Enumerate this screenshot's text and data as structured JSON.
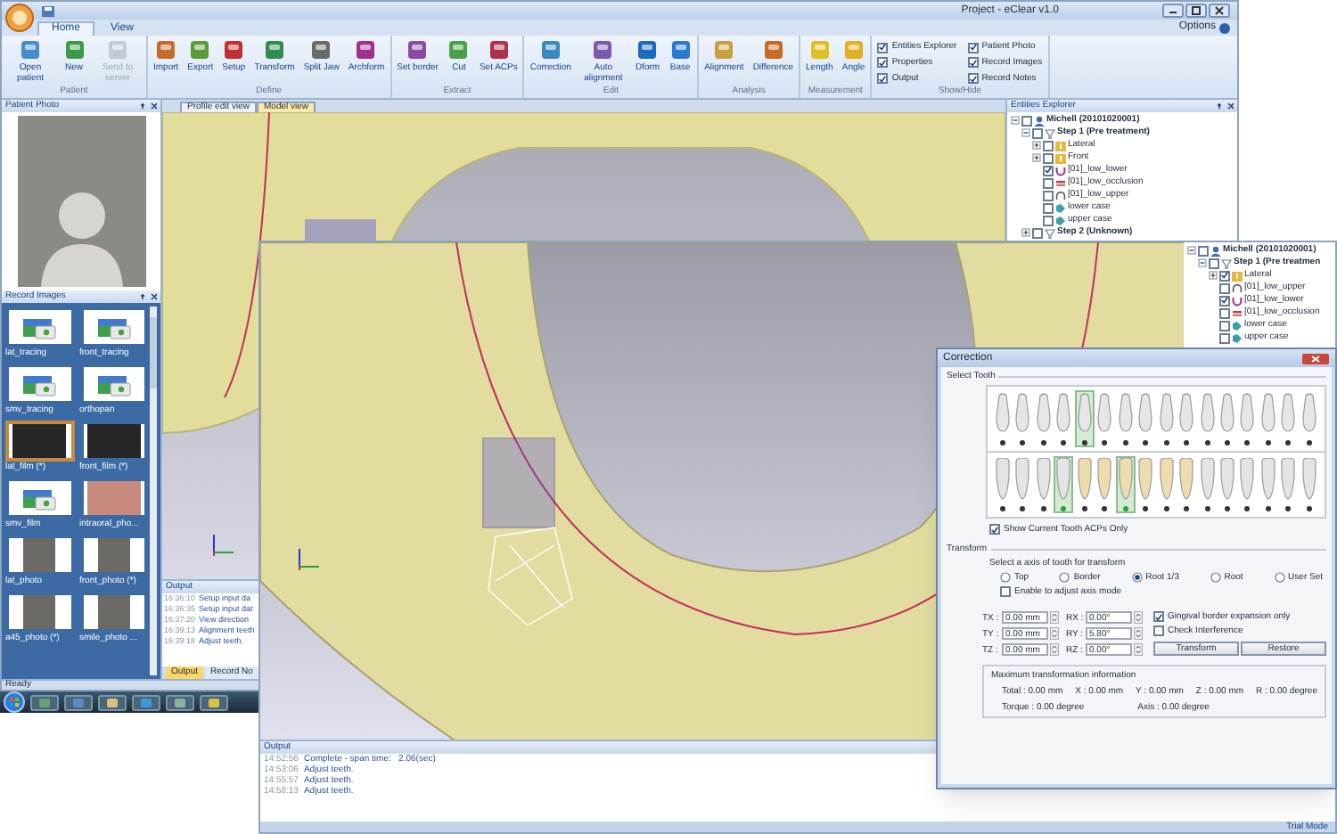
{
  "main_window": {
    "title": "Project - eClear v1.0",
    "tabs": [
      {
        "label": "Home",
        "selected": true
      },
      {
        "label": "View",
        "selected": false
      }
    ],
    "options": "Options",
    "ribbon_groups": [
      {
        "label": "Patient",
        "buttons": [
          {
            "label": "Open patient",
            "disabled": false
          },
          {
            "label": "New",
            "disabled": false
          },
          {
            "label": "Send to server",
            "disabled": true
          }
        ]
      },
      {
        "label": "Define",
        "buttons": [
          {
            "label": "Import",
            "disabled": false
          },
          {
            "label": "Export",
            "disabled": false
          },
          {
            "label": "Setup",
            "disabled": false
          },
          {
            "label": "Transform",
            "disabled": false
          },
          {
            "label": "Split Jaw",
            "disabled": false
          },
          {
            "label": "Archform",
            "disabled": false
          }
        ]
      },
      {
        "label": "Extract",
        "buttons": [
          {
            "label": "Set border",
            "disabled": false
          },
          {
            "label": "Cut",
            "disabled": false
          },
          {
            "label": "Set ACPs",
            "disabled": false
          }
        ]
      },
      {
        "label": "Edit",
        "buttons": [
          {
            "label": "Correction",
            "disabled": false
          },
          {
            "label": "Auto alignment",
            "disabled": false
          },
          {
            "label": "Dform",
            "disabled": false
          },
          {
            "label": "Base",
            "disabled": false
          }
        ]
      },
      {
        "label": "Analysis",
        "buttons": [
          {
            "label": "Alignment",
            "disabled": false
          },
          {
            "label": "Difference",
            "disabled": false
          }
        ]
      },
      {
        "label": "Measurement",
        "buttons": [
          {
            "label": "Length",
            "disabled": false
          },
          {
            "label": "Angle",
            "disabled": false
          }
        ]
      }
    ],
    "show_hide": {
      "label": "Show/Hide",
      "items": [
        {
          "label": "Entities Explorer",
          "checked": true
        },
        {
          "label": "Properties",
          "checked": true
        },
        {
          "label": "Output",
          "checked": true
        },
        {
          "label": "Patient Photo",
          "checked": true
        },
        {
          "label": "Record Images",
          "checked": true
        },
        {
          "label": "Record Notes",
          "checked": true
        }
      ]
    },
    "patient_photo": {
      "title": "Patient Photo"
    },
    "record_images": {
      "title": "Record Images",
      "items": [
        {
          "label": "lat_tracing",
          "kind": "icon",
          "selected": false
        },
        {
          "label": "front_tracing",
          "kind": "icon",
          "selected": false
        },
        {
          "label": "smv_tracing",
          "kind": "icon",
          "selected": false
        },
        {
          "label": "orthopan",
          "kind": "icon",
          "selected": false
        },
        {
          "label": "lat_film (*)",
          "kind": "xray",
          "selected": true
        },
        {
          "label": "front_film (*)",
          "kind": "xray",
          "selected": false
        },
        {
          "label": "smv_film",
          "kind": "icon",
          "selected": false
        },
        {
          "label": "intraoral_pho...",
          "kind": "intraoral",
          "selected": false
        },
        {
          "label": "lat_photo",
          "kind": "photo",
          "selected": false
        },
        {
          "label": "front_photo (*)",
          "kind": "photo",
          "selected": false
        },
        {
          "label": "a45_photo (*)",
          "kind": "photo",
          "selected": false
        },
        {
          "label": "smile_photo ...",
          "kind": "photo",
          "selected": false
        }
      ]
    },
    "view_tabs": [
      {
        "label": "Profile edit view",
        "selected": false
      },
      {
        "label": "Model view",
        "selected": true
      }
    ],
    "entities_explorer": {
      "title": "Entities Explorer",
      "tree": [
        {
          "label": "Michell (20101020001)",
          "kind": "patient",
          "checked": false,
          "expanded": true,
          "children": [
            {
              "label": "Step 1 (Pre treatment)",
              "kind": "step",
              "checked": false,
              "expanded": true,
              "children": [
                {
                  "label": "Lateral",
                  "kind": "group",
                  "checked": false,
                  "expanded": false
                },
                {
                  "label": "Front",
                  "kind": "group",
                  "checked": false,
                  "expanded": false
                },
                {
                  "label": "[01]_low_lower",
                  "kind": "arch",
                  "checked": true
                },
                {
                  "label": "[01]_low_occlusion",
                  "kind": "occlusion",
                  "checked": false
                },
                {
                  "label": "[01]_low_upper",
                  "kind": "upper",
                  "checked": false
                },
                {
                  "label": "lower case",
                  "kind": "case",
                  "checked": false
                },
                {
                  "label": "upper case",
                  "kind": "case",
                  "checked": false
                }
              ]
            },
            {
              "label": "Step 2 (Unknown)",
              "kind": "step",
              "checked": false,
              "expanded": false
            }
          ]
        }
      ]
    },
    "output": {
      "title": "Output",
      "lines": [
        {
          "time": "16:36:10",
          "text": "Setup input da"
        },
        {
          "time": "16:36:35",
          "text": "Setup input dat"
        },
        {
          "time": "16:37:20",
          "text": "View direction"
        },
        {
          "time": "16:39:13",
          "text": "Alignment teeth"
        },
        {
          "time": "16:39:18",
          "text": "Adjust teeth."
        }
      ],
      "tabs": [
        {
          "label": "Output",
          "selected": true
        },
        {
          "label": "Record No",
          "selected": false
        }
      ]
    },
    "status": "Ready"
  },
  "second_window": {
    "entities_tree": [
      {
        "label": "Michell (20101020001)",
        "kind": "patient",
        "checked": false,
        "expanded": true,
        "children": [
          {
            "label": "Step 1 (Pre treatmen",
            "kind": "step",
            "checked": false,
            "expanded": true,
            "children": [
              {
                "label": "Lateral",
                "kind": "group",
                "checked": true,
                "expanded": false
              },
              {
                "label": "[01]_low_upper",
                "kind": "upper",
                "checked": false
              },
              {
                "label": "[01]_low_lower",
                "kind": "arch",
                "checked": true
              },
              {
                "label": "[01]_low_occlusion",
                "kind": "occlusion",
                "checked": false
              },
              {
                "label": "lower case",
                "kind": "case",
                "checked": false
              },
              {
                "label": "upper case",
                "kind": "case",
                "checked": false
              }
            ]
          }
        ]
      }
    ],
    "output": {
      "title": "Output",
      "lines": [
        {
          "time": "14:52:56",
          "text": "Complete - span time:   2.06(sec)"
        },
        {
          "time": "14:53:06",
          "text": "Adjust teeth."
        },
        {
          "time": "14:55:57",
          "text": "Adjust teeth."
        },
        {
          "time": "14:58:13",
          "text": "Adjust teeth."
        }
      ]
    },
    "status": "Trial Mode"
  },
  "correction_dialog": {
    "title": "Correction",
    "select_tooth_label": "Select Tooth",
    "upper_teeth": [
      {
        "selected": false
      },
      {
        "selected": false
      },
      {
        "selected": false
      },
      {
        "selected": false
      },
      {
        "selected": true
      },
      {
        "selected": false
      },
      {
        "selected": false
      },
      {
        "selected": false
      },
      {
        "selected": false
      },
      {
        "selected": false
      },
      {
        "selected": false
      },
      {
        "selected": false
      },
      {
        "selected": false
      },
      {
        "selected": false
      },
      {
        "selected": false
      },
      {
        "selected": false
      }
    ],
    "lower_teeth": [
      {
        "selected": false,
        "color": "#e4e4e4"
      },
      {
        "selected": false,
        "color": "#e4e4e4"
      },
      {
        "selected": false,
        "color": "#e4e4e4"
      },
      {
        "selected": true,
        "color": "#e4e4e4"
      },
      {
        "selected": false,
        "color": "#ecdcae"
      },
      {
        "selected": false,
        "color": "#ecdcae"
      },
      {
        "selected": true,
        "color": "#ecdcae"
      },
      {
        "selected": false,
        "color": "#ecdcae"
      },
      {
        "selected": false,
        "color": "#ecdcae"
      },
      {
        "selected": false,
        "color": "#ecdcae"
      },
      {
        "selected": false,
        "color": "#e4e4e4"
      },
      {
        "selected": false,
        "color": "#e4e4e4"
      },
      {
        "selected": false,
        "color": "#e4e4e4"
      },
      {
        "selected": false,
        "color": "#e4e4e4"
      },
      {
        "selected": false,
        "color": "#e4e4e4"
      },
      {
        "selected": false,
        "color": "#e4e4e4"
      }
    ],
    "show_current": {
      "label": "Show Current Tooth ACPs Only",
      "checked": true
    },
    "transform_label": "Transform",
    "axis_prompt": "Select a axis of tooth for transform",
    "axes": [
      {
        "label": "Top",
        "selected": false
      },
      {
        "label": "Border",
        "selected": false
      },
      {
        "label": "Root 1/3",
        "selected": true
      },
      {
        "label": "Root",
        "selected": false
      },
      {
        "label": "User Set",
        "selected": false
      }
    ],
    "adjust_axis": {
      "label": "Enable to adjust axis mode",
      "checked": false
    },
    "fields": [
      {
        "label": "TX :",
        "value": "0.00 mm"
      },
      {
        "label": "RX :",
        "value": "0.00°"
      },
      {
        "label": "TY :",
        "value": "0.00 mm"
      },
      {
        "label": "RY :",
        "value": "5.80°"
      },
      {
        "label": "TZ :",
        "value": "0.00 mm"
      },
      {
        "label": "RZ :",
        "value": "0.00°"
      }
    ],
    "options": [
      {
        "label": "Gingival border expansion only",
        "checked": true
      },
      {
        "label": "Check Interference",
        "checked": false
      }
    ],
    "buttons": [
      "Transform",
      "Restore"
    ],
    "max_info": {
      "title": "Maximum transformation information",
      "row_1": [
        "Total : 0.00 mm",
        "X : 0.00 mm",
        "Y : 0.00 mm",
        "Z : 0.00 mm",
        "R : 0.00 degree"
      ],
      "row_2": [
        "Torque : 0.00 degree",
        "Axis : 0.00 degree"
      ]
    }
  }
}
